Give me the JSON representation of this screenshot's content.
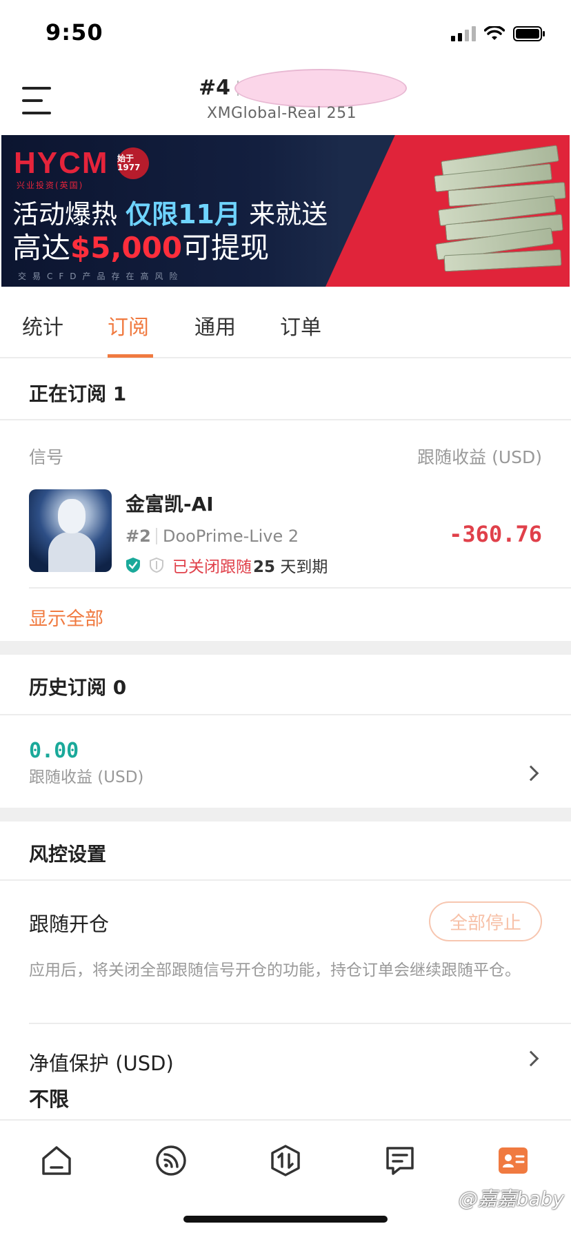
{
  "status_bar": {
    "time": "9:50"
  },
  "header": {
    "account_rank": "#4",
    "account_number_partial": "2",
    "server": "XMGlobal-Real 251"
  },
  "banner": {
    "logo": "HYCM",
    "logo_sub": "兴业投资(英国)",
    "seal_text": "始于 1977",
    "line1_a": "活动爆热 ",
    "line1_highlight": "仅限11月",
    "line1_b": " 来就送",
    "line2_a": "高达",
    "line2_amount": "$5,000",
    "line2_b": "可提现",
    "risk_notice": "交易CFD产品存在高风险"
  },
  "tabs": [
    {
      "label": "统计"
    },
    {
      "label": "订阅"
    },
    {
      "label": "通用"
    },
    {
      "label": "订单"
    }
  ],
  "active_tab_index": 1,
  "subscribing": {
    "title": "正在订阅 1",
    "col_signal": "信号",
    "col_profit": "跟随收益 (USD)",
    "signal": {
      "name": "金富凯-AI",
      "rank": "#2",
      "broker": "DooPrime-Live 2",
      "closed_text": "已关闭跟随",
      "days_number": "25",
      "days_suffix": " 天到期",
      "profit": "-360.76"
    },
    "show_all": "显示全部"
  },
  "history": {
    "title": "历史订阅 0",
    "value": "0.00",
    "label": "跟随收益 (USD)"
  },
  "risk_control": {
    "title": "风控设置",
    "follow_open_label": "跟随开仓",
    "stop_all_button": "全部停止",
    "follow_open_desc": "应用后，将关闭全部跟随信号开仓的功能，持仓订单会继续跟随平仓。",
    "equity_protect_label": "净值保护 (USD)",
    "equity_protect_value": "不限"
  },
  "watermark": "@嘉嘉baby",
  "colors": {
    "accent": "#f07a40",
    "loss": "#e0404a",
    "gain": "#1aa99a"
  }
}
